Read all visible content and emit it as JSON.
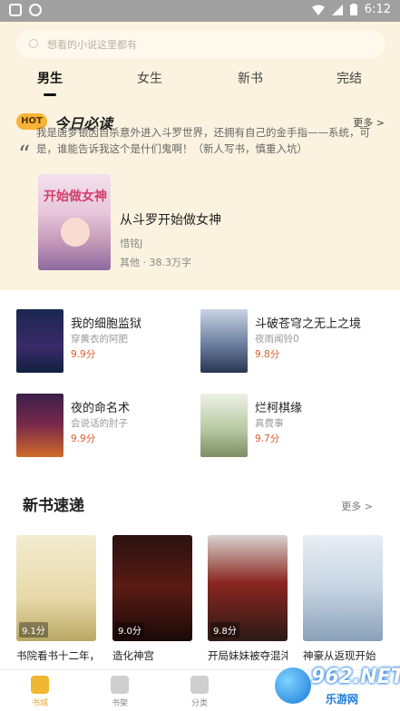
{
  "status": {
    "time": "6:12"
  },
  "search": {
    "placeholder": "想看的小说这里都有"
  },
  "tabs": [
    {
      "label": "男生"
    },
    {
      "label": "女生"
    },
    {
      "label": "新书"
    },
    {
      "label": "完结"
    }
  ],
  "hot": {
    "badge": "HOT",
    "title": "今日必读",
    "more": "更多 >"
  },
  "featured": {
    "quote": "我是唐梦银因自杀意外进入斗罗世界，还拥有自己的金手指——系统，可是，谁能告诉我这个是什们鬼啊！（新人写书，慎重入坑）",
    "cover_text": "开始做女神",
    "title": "从斗罗开始做女神",
    "author": "惜铭J",
    "meta": "其他 · 38.3万字"
  },
  "grid_books": [
    {
      "title": "我的细胞监狱",
      "author": "穿黄衣的阿肥",
      "score": "9.9分"
    },
    {
      "title": "斗破苍穹之无上之境",
      "author": "夜雨闻铃0",
      "score": "9.8分"
    },
    {
      "title": "夜的命名术",
      "author": "会说话的肘子",
      "score": "9.9分"
    },
    {
      "title": "烂柯棋缘",
      "author": "真费事",
      "score": "9.7分"
    }
  ],
  "new_section": {
    "title": "新书速递",
    "more": "更多 >",
    "books": [
      {
        "title": "书院看书十二年，我已经无敌了",
        "score": "9.1分"
      },
      {
        "title": "造化神宫",
        "score": "9.0分"
      },
      {
        "title": "开局妹妹被夺混沌血",
        "score": "9.8分"
      },
      {
        "title": "神豪从返现开始",
        "score": ""
      }
    ]
  },
  "bottom_nav": [
    {
      "label": "书城"
    },
    {
      "label": "书架"
    },
    {
      "label": "分类"
    }
  ],
  "watermark": {
    "brand": "962.NET",
    "sub": "乐游网"
  },
  "colors": {
    "accent": "#f0b830",
    "top_bg": "#fbf3df",
    "score": "#e05a2a"
  }
}
